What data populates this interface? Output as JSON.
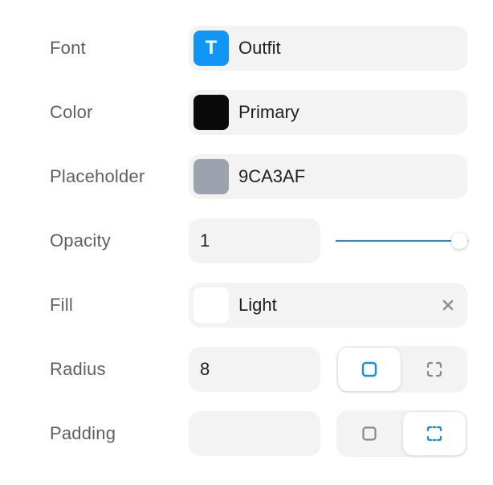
{
  "rows": {
    "font": {
      "label": "Font",
      "swatch_glyph": "T",
      "value": "Outfit",
      "swatch_color": "#1296F5",
      "icon": "text-type-icon"
    },
    "color": {
      "label": "Color",
      "value": "Primary",
      "swatch_color": "#0A0A0A"
    },
    "placeholder": {
      "label": "Placeholder",
      "value": "9CA3AF",
      "swatch_color": "#9CA3AF"
    },
    "opacity": {
      "label": "Opacity",
      "value": "1",
      "slider_value": 1.0,
      "accent_color": "#1C8EE8"
    },
    "fill": {
      "label": "Fill",
      "value": "Light",
      "swatch_color": "#FFFFFF",
      "clear_icon": "close-icon"
    },
    "radius": {
      "label": "Radius",
      "value": "8",
      "mode_options": [
        {
          "icon": "uniform-corner-icon",
          "selected": true
        },
        {
          "icon": "individual-corners-icon",
          "selected": false
        }
      ]
    },
    "padding": {
      "label": "Padding",
      "value": "",
      "mode_options": [
        {
          "icon": "uniform-padding-icon",
          "selected": false
        },
        {
          "icon": "individual-sides-icon",
          "selected": true
        }
      ]
    }
  },
  "colors": {
    "accent": "#1C8EE8",
    "field_bg": "#F3F3F3",
    "label_text": "#5F5F5F",
    "inactive_icon": "#8A8A8A"
  }
}
